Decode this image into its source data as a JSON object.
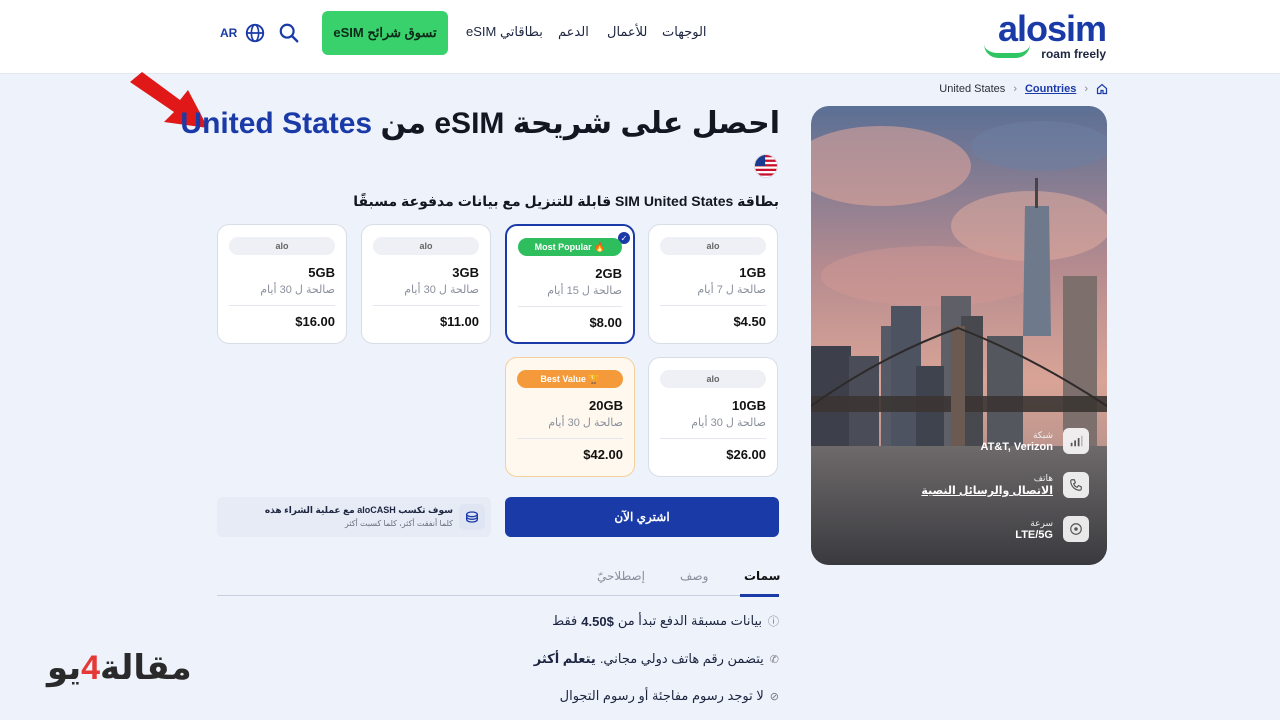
{
  "header": {
    "logo_word": "alosim",
    "logo_tagline": "roam freely",
    "nav": [
      "الوجهات",
      "للأعمال",
      "الدعم",
      "بطاقاتي eSIM"
    ],
    "shop_button": "تسوق شرائح eSIM",
    "lang": "AR"
  },
  "breadcrumb": [
    "Countries",
    "United States"
  ],
  "title": {
    "prefix": "احصل على شريحة eSIM من ",
    "country": "United States"
  },
  "subtitle": "بطاقة SIM United States قابلة للتنزيل مع بيانات مدفوعة مسبقًا",
  "plans": [
    {
      "badge": "alo",
      "data": "1GB",
      "validity": "صالحة ل 7 أيام",
      "price": "$4.50"
    },
    {
      "badge": "Most Popular 🔥",
      "data": "2GB",
      "validity": "صالحة ل 15 أيام",
      "price": "$8.00",
      "selected": true
    },
    {
      "badge": "alo",
      "data": "3GB",
      "validity": "صالحة ل 30 أيام",
      "price": "$11.00"
    },
    {
      "badge": "alo",
      "data": "5GB",
      "validity": "صالحة ل 30 أيام",
      "price": "$16.00"
    },
    {
      "badge": "alo",
      "data": "10GB",
      "validity": "صالحة ل 30 أيام",
      "price": "$26.00"
    },
    {
      "badge": "Best Value 🏆",
      "data": "20GB",
      "validity": "صالحة ل 30 أيام",
      "price": "$42.00"
    }
  ],
  "buy_button": "اشتري الآن",
  "cashback": {
    "line1": "سوف تكسب aloCASH مع عملية الشراء هذه",
    "line2": "كلما أنفقت أكثر، كلما كسبت أكثر"
  },
  "tabs": [
    "سمات",
    "وصف",
    "إصطلاحيّ"
  ],
  "features": [
    {
      "text": "بيانات مسبقة الدفع تبدأ من ",
      "bold": "4.50$",
      "after": " فقط"
    },
    {
      "text": "يتضمن رقم هاتف دولي مجاني. ",
      "bold": "يتعلم أكثر",
      "after": ""
    },
    {
      "text": "لا توجد رسوم مفاجئة أو رسوم التجوال",
      "bold": "",
      "after": ""
    }
  ],
  "photo_info": [
    {
      "label": "شبكة",
      "value": "AT&T, Verizon",
      "icon": "signal-icon"
    },
    {
      "label": "هاتف",
      "value": "الاتصال والرسائل النصية",
      "icon": "phone-icon"
    },
    {
      "label": "سرعة",
      "value": "LTE/5G",
      "icon": "speed-icon"
    }
  ],
  "watermark": {
    "part1": "مقالة",
    "four": "4",
    "part2": "يو"
  },
  "colors": {
    "brand": "#1a3aa8",
    "green": "#38d16c",
    "orange": "#f59a3a",
    "background": "#eef2fb"
  }
}
